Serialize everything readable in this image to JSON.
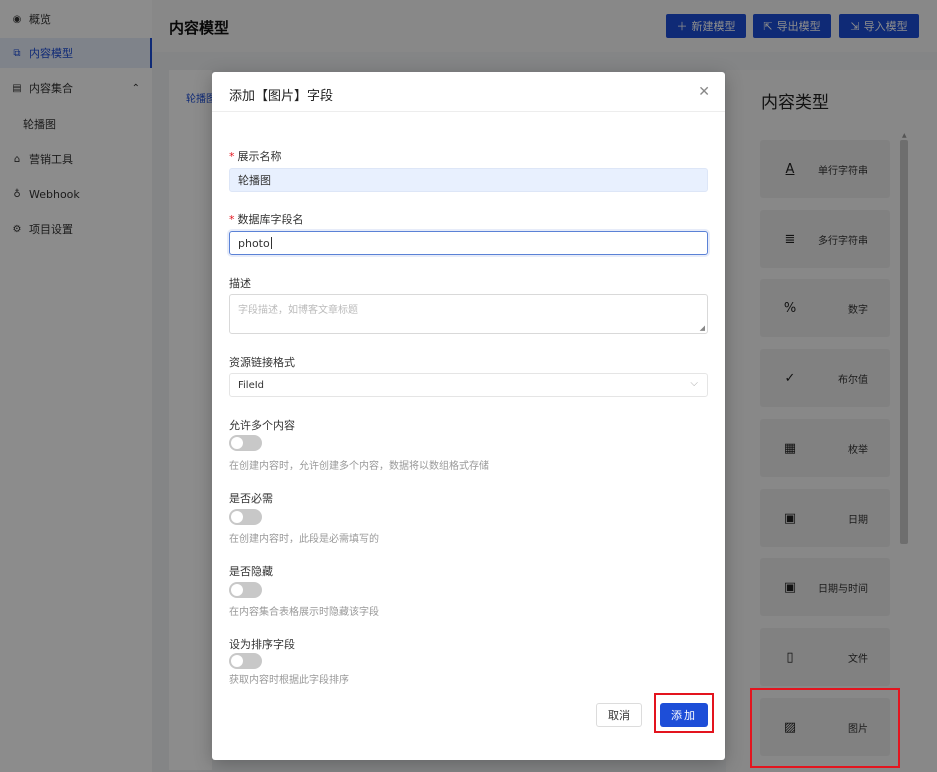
{
  "sidebar": {
    "items": [
      {
        "label": "概览",
        "icon": "eye-icon"
      },
      {
        "label": "内容模型",
        "icon": "sitemap-icon",
        "active": true
      },
      {
        "label": "内容集合",
        "icon": "database-icon",
        "expanded": true
      },
      {
        "label": "轮播图",
        "sub": true
      },
      {
        "label": "营销工具",
        "icon": "shop-icon"
      },
      {
        "label": "Webhook",
        "icon": "webhook-icon"
      },
      {
        "label": "项目设置",
        "icon": "gear-icon"
      }
    ]
  },
  "header": {
    "title": "内容模型",
    "buttons": [
      {
        "label": "新建模型",
        "icon": "plus-icon"
      },
      {
        "label": "导出模型",
        "icon": "export-icon"
      },
      {
        "label": "导入模型",
        "icon": "import-icon"
      }
    ]
  },
  "left_panel": {
    "tab": "轮播图"
  },
  "right_panel": {
    "title": "内容类型",
    "types": [
      {
        "label": "单行字符串",
        "icon": "text-icon"
      },
      {
        "label": "多行字符串",
        "icon": "multiline-icon"
      },
      {
        "label": "数字",
        "icon": "percent-icon"
      },
      {
        "label": "布尔值",
        "icon": "check-icon"
      },
      {
        "label": "枚举",
        "icon": "enum-icon"
      },
      {
        "label": "日期",
        "icon": "calendar-icon"
      },
      {
        "label": "日期与时间",
        "icon": "calendar-time-icon"
      },
      {
        "label": "文件",
        "icon": "file-icon"
      },
      {
        "label": "图片",
        "icon": "image-icon"
      }
    ]
  },
  "modal": {
    "title": "添加【图片】字段",
    "fields": {
      "display_name": {
        "label": "展示名称",
        "value": "轮播图"
      },
      "db_field": {
        "label": "数据库字段名",
        "value": "photo"
      },
      "description": {
        "label": "描述",
        "placeholder": "字段描述，如博客文章标题"
      },
      "resource_format": {
        "label": "资源链接格式",
        "value": "FileId"
      },
      "allow_multiple": {
        "label": "允许多个内容",
        "hint": "在创建内容时，允许创建多个内容，数据将以数组格式存储",
        "on": false
      },
      "required": {
        "label": "是否必需",
        "hint": "在创建内容时，此段是必需填写的",
        "on": false
      },
      "hidden": {
        "label": "是否隐藏",
        "hint": "在内容集合表格展示时隐藏该字段",
        "on": false
      },
      "sort_field": {
        "label": "设为排序字段",
        "hint": "获取内容时根据此字段排序",
        "on": false
      }
    },
    "cancel_label": "取消",
    "add_label": "添加"
  },
  "colors": {
    "primary": "#1d4ed8",
    "highlight": "#e3141e"
  }
}
